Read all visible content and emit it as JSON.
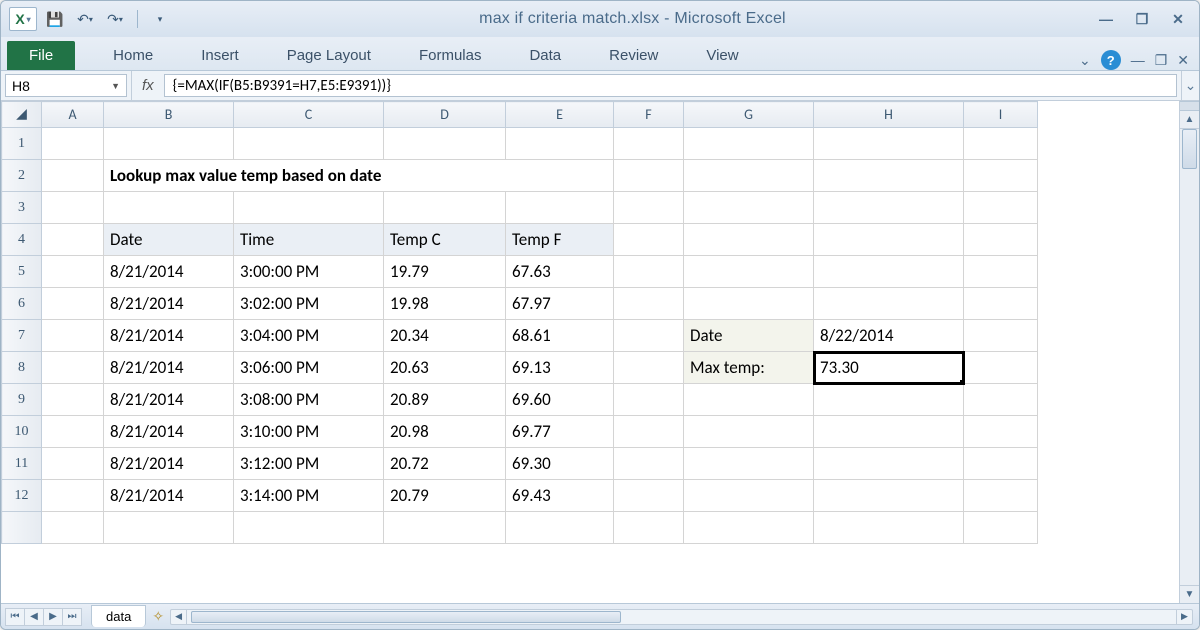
{
  "title": "max if criteria match.xlsx - Microsoft Excel",
  "namebox": "H8",
  "formula": "{=MAX(IF(B5:B9391=H7,E5:E9391))}",
  "tabs": {
    "file": "File",
    "home": "Home",
    "insert": "Insert",
    "page_layout": "Page Layout",
    "formulas": "Formulas",
    "data": "Data",
    "review": "Review",
    "view": "View"
  },
  "columns": [
    "A",
    "B",
    "C",
    "D",
    "E",
    "F",
    "G",
    "H",
    "I"
  ],
  "active_col": "H",
  "active_row": 8,
  "heading": "Lookup max value temp based on date",
  "table": {
    "headers": {
      "b": "Date",
      "c": "Time",
      "d": "Temp C",
      "e": "Temp F"
    },
    "rows": [
      {
        "r": 5,
        "b": "8/21/2014",
        "c": "3:00:00 PM",
        "d": "19.79",
        "e": "67.63"
      },
      {
        "r": 6,
        "b": "8/21/2014",
        "c": "3:02:00 PM",
        "d": "19.98",
        "e": "67.97"
      },
      {
        "r": 7,
        "b": "8/21/2014",
        "c": "3:04:00 PM",
        "d": "20.34",
        "e": "68.61"
      },
      {
        "r": 8,
        "b": "8/21/2014",
        "c": "3:06:00 PM",
        "d": "20.63",
        "e": "69.13"
      },
      {
        "r": 9,
        "b": "8/21/2014",
        "c": "3:08:00 PM",
        "d": "20.89",
        "e": "69.60"
      },
      {
        "r": 10,
        "b": "8/21/2014",
        "c": "3:10:00 PM",
        "d": "20.98",
        "e": "69.77"
      },
      {
        "r": 11,
        "b": "8/21/2014",
        "c": "3:12:00 PM",
        "d": "20.72",
        "e": "69.30"
      },
      {
        "r": 12,
        "b": "8/21/2014",
        "c": "3:14:00 PM",
        "d": "20.79",
        "e": "69.43"
      }
    ]
  },
  "lookup": {
    "date_label": "Date",
    "date_value": "8/22/2014",
    "max_label": "Max temp:",
    "max_value": "73.30"
  },
  "sheet_tab": "data"
}
